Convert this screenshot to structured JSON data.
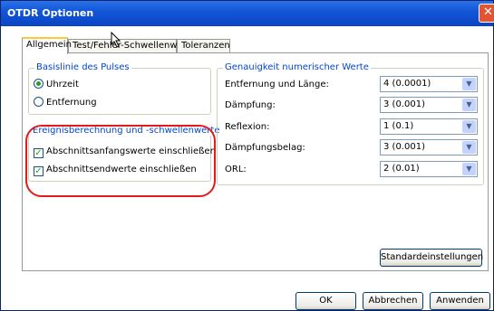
{
  "window": {
    "title": "OTDR Optionen",
    "close_glyph": "✕"
  },
  "tabs": [
    {
      "label": "Allgemein",
      "active": true
    },
    {
      "label": "Test/Fehler-Schwellenw.",
      "active": false
    },
    {
      "label": "Toleranzen",
      "active": false
    }
  ],
  "baseline_group": {
    "label": "Basislinie des Pulses",
    "options": [
      {
        "label": "Uhrzeit",
        "selected": true
      },
      {
        "label": "Entfernung",
        "selected": false
      }
    ]
  },
  "event_group": {
    "label": "Ereignisberechnung und -schwellenwerte",
    "checks": [
      {
        "label": "Abschnittsanfangswerte einschließen",
        "checked": true
      },
      {
        "label": "Abschnittsendwerte einschließen",
        "checked": true
      }
    ]
  },
  "precision_group": {
    "label": "Genauigkeit numerischer Werte",
    "fields": [
      {
        "label": "Entfernung und Länge:",
        "value": "4 (0.0001)"
      },
      {
        "label": "Dämpfung:",
        "value": "3 (0.001)"
      },
      {
        "label": "Reflexion:",
        "value": "1 (0.1)"
      },
      {
        "label": "Dämpfungsbelag:",
        "value": "3 (0.001)"
      },
      {
        "label": "ORL:",
        "value": "2 (0.01)"
      }
    ]
  },
  "buttons": {
    "defaults": "Standardeinstellungen",
    "ok": "OK",
    "cancel": "Abbrechen",
    "apply": "Anwenden"
  },
  "icons": {
    "check": "✓",
    "dropdown": "▼"
  },
  "colors": {
    "title_bar": "#0a44c4",
    "group_label": "#0046d5",
    "highlight": "#e41b1b"
  }
}
